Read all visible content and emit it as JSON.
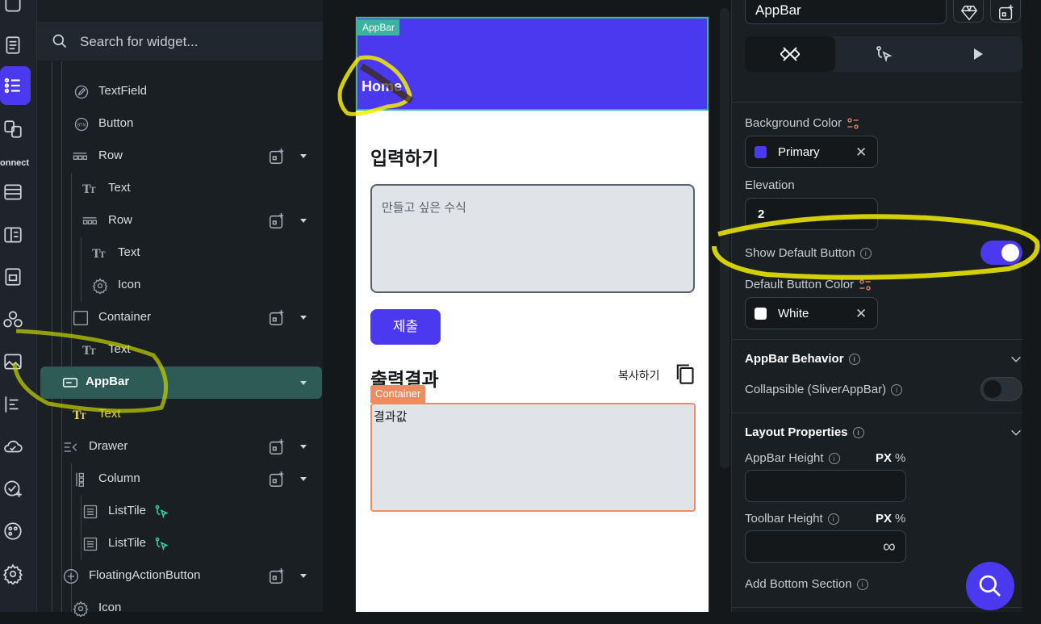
{
  "rail": {
    "connect_label": "onnect",
    "icons": [
      "layers-icon",
      "pages-icon",
      "widget-tree-icon",
      "components-icon",
      "database-icon",
      "api-icon",
      "folder-icon",
      "integrations-icon",
      "media-icon",
      "align-icon",
      "cloud-icon",
      "check-plus-icon",
      "theme-icon",
      "settings-icon"
    ]
  },
  "tree": {
    "search_placeholder": "Search for widget...",
    "nodes": [
      {
        "label": "TextField",
        "icon": "textfield-icon"
      },
      {
        "label": "Button",
        "icon": "button-icon"
      },
      {
        "label": "Row",
        "icon": "row-icon"
      },
      {
        "label": "Text",
        "icon": "text-icon"
      },
      {
        "label": "Row",
        "icon": "row-icon"
      },
      {
        "label": "Text",
        "icon": "text-icon"
      },
      {
        "label": "Icon",
        "icon": "gear-icon"
      },
      {
        "label": "Container",
        "icon": "container-icon"
      },
      {
        "label": "Text",
        "icon": "text-icon"
      },
      {
        "label": "AppBar",
        "icon": "appbar-icon",
        "selected": true
      },
      {
        "label": "Text",
        "icon": "text-icon"
      },
      {
        "label": "Drawer",
        "icon": "drawer-icon"
      },
      {
        "label": "Column",
        "icon": "column-icon"
      },
      {
        "label": "ListTile",
        "icon": "listtile-icon"
      },
      {
        "label": "ListTile",
        "icon": "listtile-icon"
      },
      {
        "label": "FloatingActionButton",
        "icon": "plus-circle-icon"
      },
      {
        "label": "Icon",
        "icon": "gear-icon"
      }
    ]
  },
  "canvas": {
    "appbar_tag": "AppBar",
    "appbar_title": "Home",
    "input_heading": "입력하기",
    "input_placeholder": "만들고 싶은 수식",
    "submit_label": "제출",
    "output_heading": "출력결과",
    "copy_label": "복사하기",
    "container_tag": "Container",
    "result_text": "결과값",
    "colors": {
      "primary": "#4b39ef",
      "appbar_outline": "#3bb3a0",
      "container_outline": "#ee8b60"
    }
  },
  "props": {
    "widget_name": "AppBar",
    "background_color_label": "Background Color",
    "background_color_value": "Primary",
    "elevation_label": "Elevation",
    "elevation_value": "2",
    "show_default_button_label": "Show Default Button",
    "show_default_button_on": true,
    "default_button_color_label": "Default Button Color",
    "default_button_color_value": "White",
    "appbar_behavior_title": "AppBar Behavior",
    "collapsible_label": "Collapsible (SliverAppBar)",
    "collapsible_on": false,
    "layout_properties_title": "Layout Properties",
    "appbar_height_label": "AppBar Height",
    "toolbar_height_label": "Toolbar Height",
    "unit_px": "PX",
    "unit_pct": "%",
    "toolbar_height_value": "∞",
    "add_bottom_section_label": "Add Bottom Section"
  }
}
